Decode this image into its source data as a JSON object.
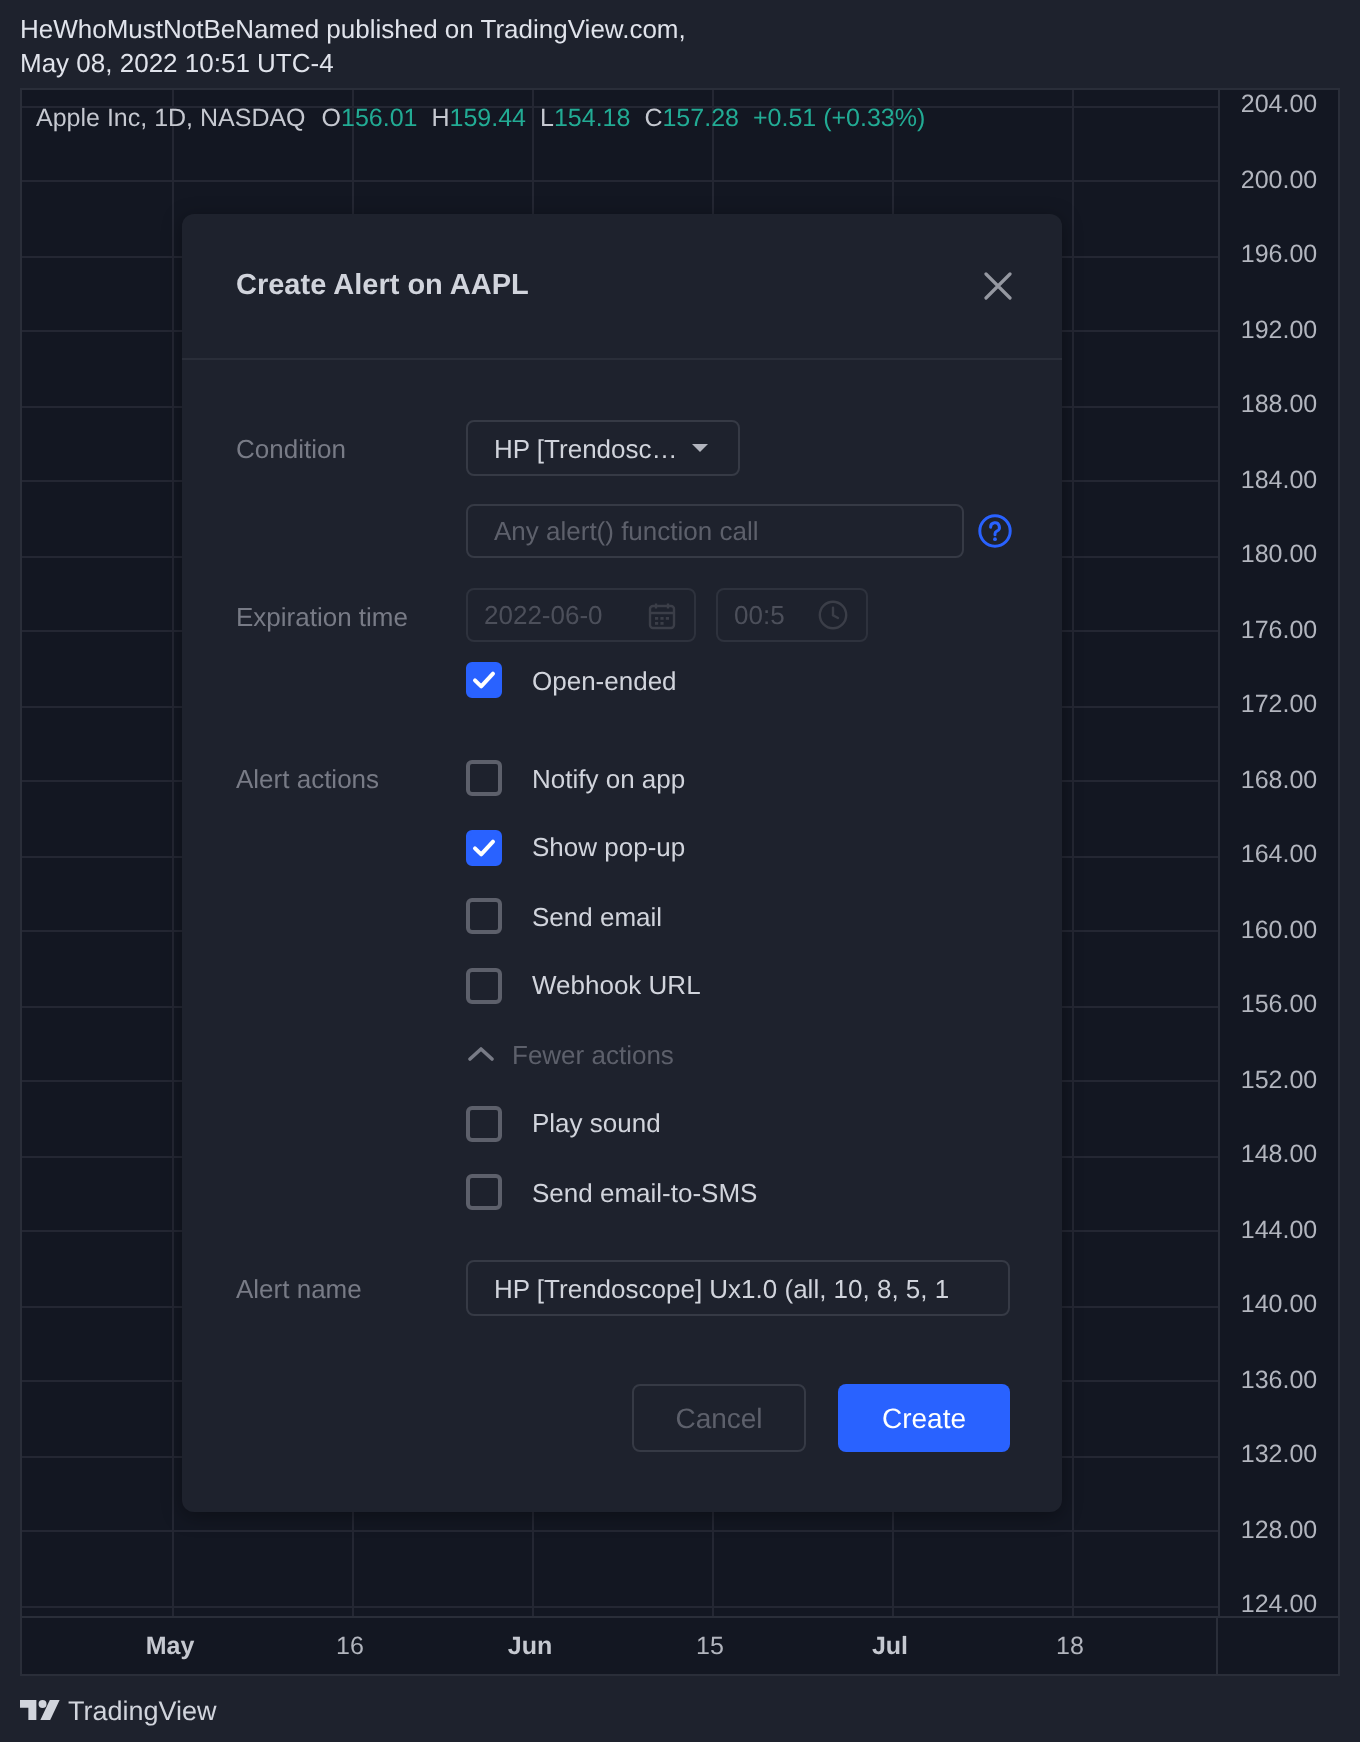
{
  "publication": {
    "author_line": "HeWhoMustNotBeNamed published on TradingView.com,",
    "date_line": "May 08, 2022 10:51 UTC-4"
  },
  "chart": {
    "legend": {
      "symbol": "Apple Inc, 1D, NASDAQ",
      "values": [
        {
          "label": "O",
          "value": "156.01"
        },
        {
          "label": "H",
          "value": "159.44"
        },
        {
          "label": "L",
          "value": "154.18"
        },
        {
          "label": "C",
          "value": "157.28"
        }
      ],
      "change": "+0.51 (+0.33%)"
    },
    "price_axis": {
      "labels": [
        "204.00",
        "200.00",
        "196.00",
        "192.00",
        "188.00",
        "184.00",
        "180.00",
        "176.00",
        "172.00",
        "168.00",
        "164.00",
        "160.00",
        "156.00",
        "152.00",
        "148.00",
        "144.00",
        "140.00",
        "136.00",
        "132.00",
        "128.00",
        "124.00"
      ]
    },
    "time_axis": {
      "labels": [
        {
          "text": "May",
          "kind": "month"
        },
        {
          "text": "16",
          "kind": "day"
        },
        {
          "text": "Jun",
          "kind": "month"
        },
        {
          "text": "15",
          "kind": "day"
        },
        {
          "text": "Jul",
          "kind": "month"
        },
        {
          "text": "18",
          "kind": "day"
        }
      ]
    }
  },
  "dialog": {
    "title": "Create Alert on AAPL",
    "condition": {
      "label": "Condition",
      "value": "HP [Trendosc…",
      "function_field": {
        "placeholder": "Any alert() function call"
      }
    },
    "expiration": {
      "label": "Expiration time",
      "date": "2022-06-0",
      "time": "00:5",
      "disabled": true,
      "open_ended": {
        "label": "Open-ended",
        "checked": true
      }
    },
    "actions": {
      "label": "Alert actions",
      "items": [
        {
          "kind": "checkbox",
          "label": "Notify on app",
          "checked": false
        },
        {
          "kind": "checkbox",
          "label": "Show pop-up",
          "checked": true
        },
        {
          "kind": "checkbox",
          "label": "Send email",
          "checked": false
        },
        {
          "kind": "checkbox",
          "label": "Webhook URL",
          "checked": false
        },
        {
          "kind": "toggle",
          "label": "Fewer actions",
          "expanded": true
        },
        {
          "kind": "checkbox",
          "label": "Play sound",
          "checked": false
        },
        {
          "kind": "checkbox",
          "label": "Send email-to-SMS",
          "checked": false
        }
      ]
    },
    "alert_name": {
      "label": "Alert name",
      "value": "HP [Trendoscope] Ux1.0 (all, 10, 8, 5, 1"
    },
    "buttons": [
      {
        "label": "Cancel",
        "kind": "secondary"
      },
      {
        "label": "Create",
        "kind": "primary"
      }
    ]
  },
  "footer": {
    "brand": "TradingView"
  }
}
